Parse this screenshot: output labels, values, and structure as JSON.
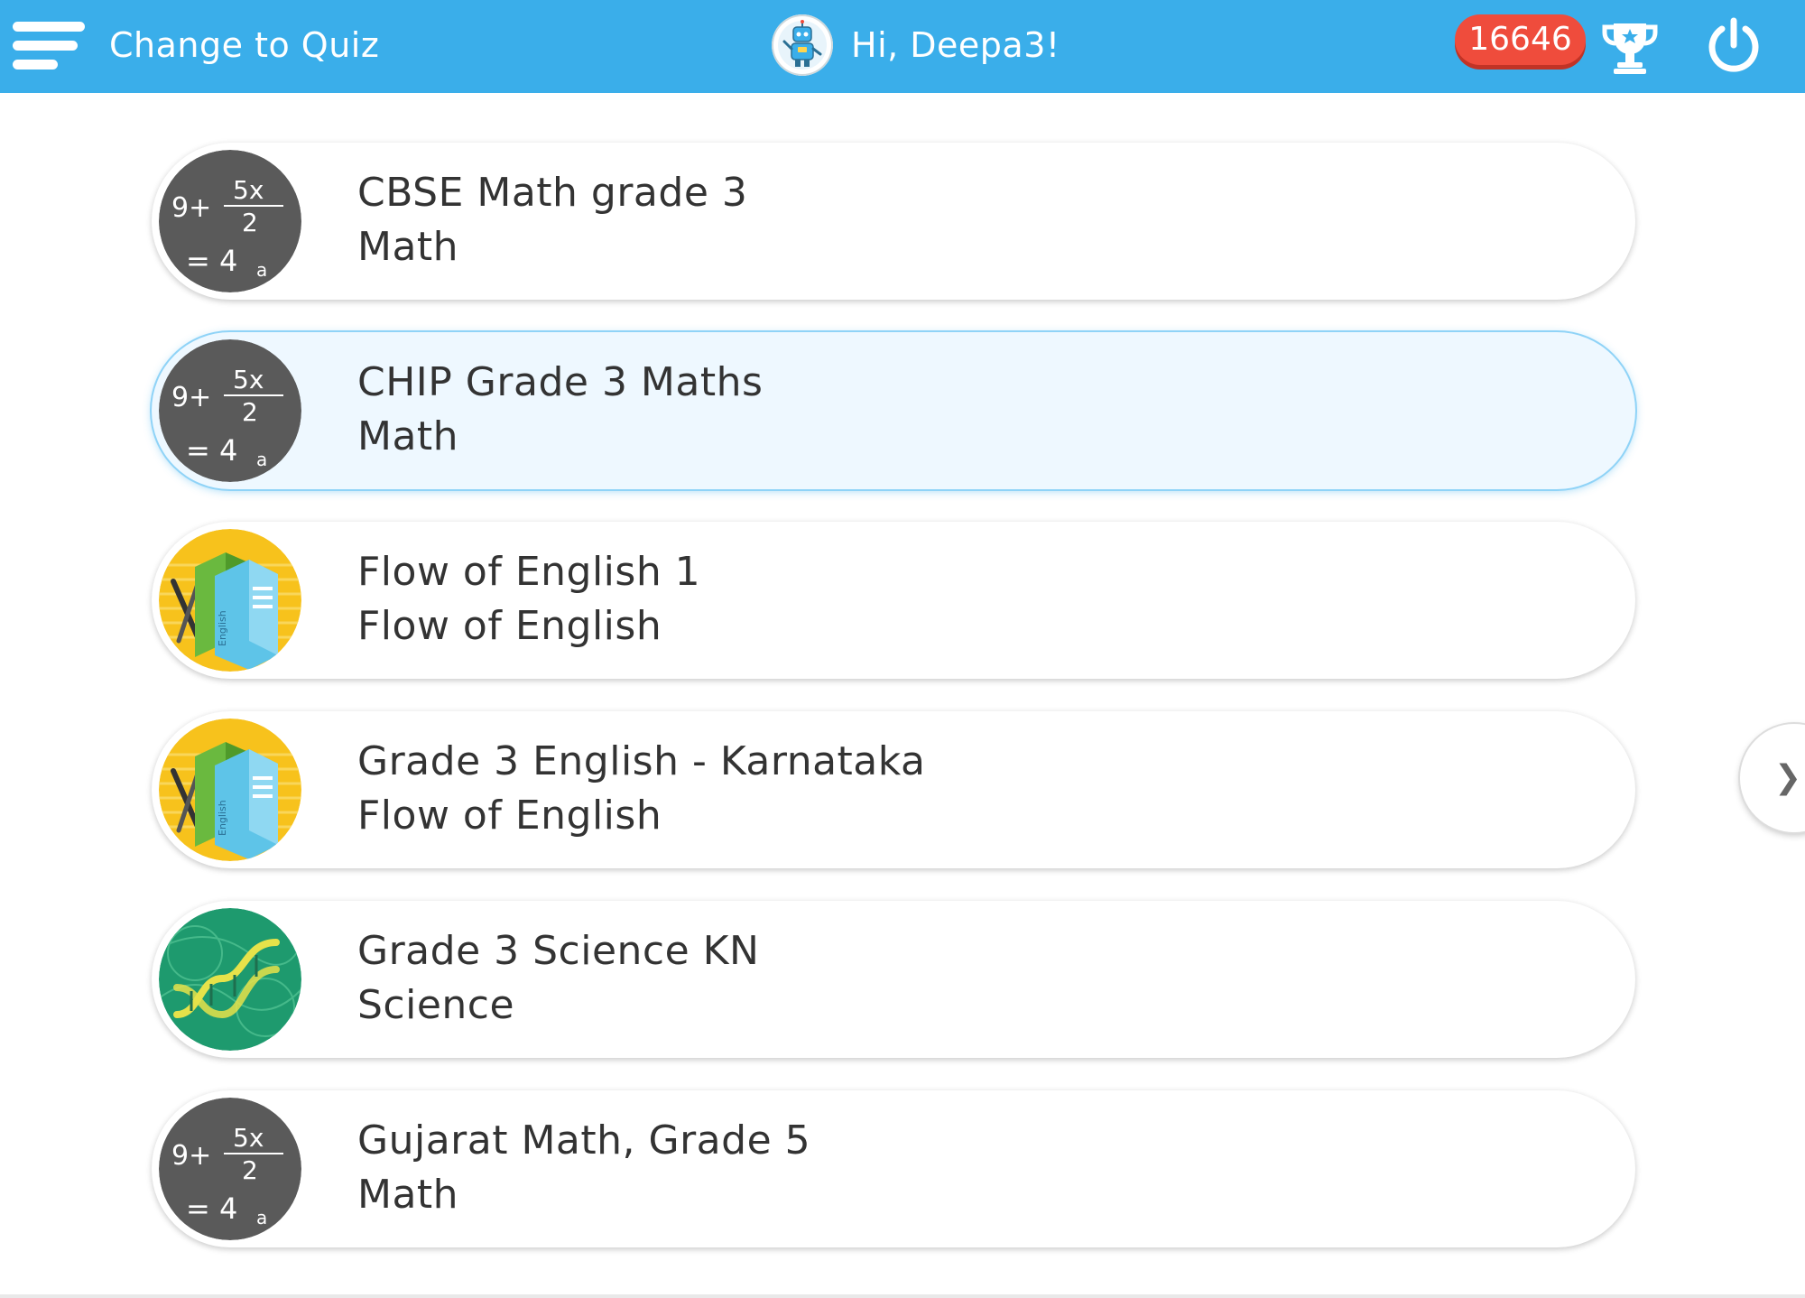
{
  "header": {
    "change_label": "Change to Quiz",
    "greeting": "Hi, Deepa3!",
    "points": "16646",
    "icons": [
      "menu-icon",
      "avatar",
      "trophy-icon",
      "power-icon"
    ],
    "bar_color": "#3aaeea",
    "badge_color": "#ef4c3c"
  },
  "courses": [
    {
      "title": "CBSE Math grade 3",
      "subject": "Math",
      "icon": "math-equation-icon",
      "selected": false
    },
    {
      "title": "CHIP Grade 3 Maths",
      "subject": "Math",
      "icon": "math-equation-icon",
      "selected": true
    },
    {
      "title": "Flow of English 1",
      "subject": "Flow of English",
      "icon": "english-books-icon",
      "selected": false
    },
    {
      "title": "Grade 3 English - Karnataka",
      "subject": "Flow of English",
      "icon": "english-books-icon",
      "selected": false
    },
    {
      "title": "Grade 3 Science KN",
      "subject": "Science",
      "icon": "dna-science-icon",
      "selected": false
    },
    {
      "title": "Gujarat Math, Grade 5",
      "subject": "Math",
      "icon": "math-equation-icon",
      "selected": false
    }
  ],
  "pager": {
    "next_icon": "chevron-right-icon"
  },
  "colors": {
    "selected_bg": "#eef8ff",
    "selected_border": "#8fd3f7"
  }
}
